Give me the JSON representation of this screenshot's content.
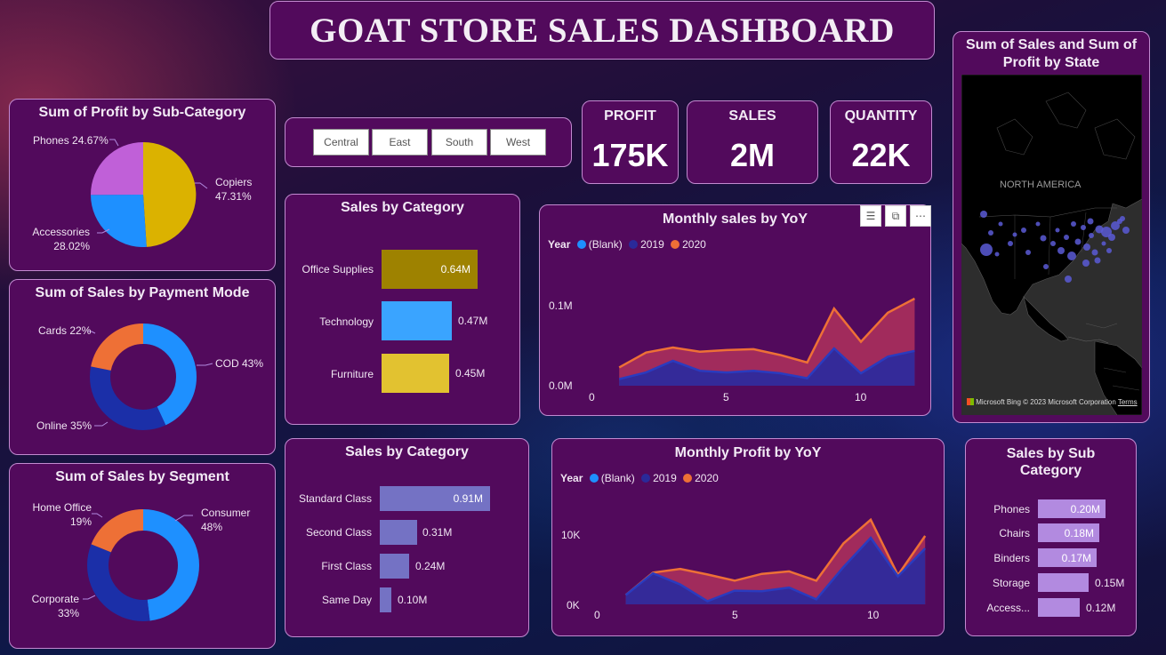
{
  "title": "GOAT STORE SALES DASHBOARD",
  "colors": {
    "card_bg": "#520a5c",
    "card_border": "#c28ad0",
    "blank": "#1e90ff",
    "y2019": "#2a2a9a",
    "y2020": "#ee7036",
    "copiers": "#dbb200",
    "accessories": "#1e90ff",
    "phones": "#c060d8",
    "shipmode_bar": "#7472c4",
    "subcat_bar": "#b28ae0"
  },
  "filters": {
    "regions": [
      "Central",
      "East",
      "South",
      "West"
    ]
  },
  "kpis": [
    {
      "label": "PROFIT",
      "value": "175K"
    },
    {
      "label": "SALES",
      "value": "2M"
    },
    {
      "label": "QUANTITY",
      "value": "22K"
    }
  ],
  "profit_subcat": {
    "title": "Sum of Profit by Sub-Category",
    "slices": [
      {
        "name": "Copiers",
        "pct_label": "47.31%",
        "value": 47.31
      },
      {
        "name": "Accessories",
        "pct_label": "28.02%",
        "value": 28.02
      },
      {
        "name": "Phones",
        "pct_label": "24.67%",
        "value": 24.67
      }
    ],
    "label_phones": "Phones 24.67%"
  },
  "payment_mode": {
    "title": "Sum of Sales by Payment Mode",
    "slices": [
      {
        "name": "COD",
        "value": 43,
        "label": "COD 43%"
      },
      {
        "name": "Online",
        "value": 35,
        "label": "Online 35%"
      },
      {
        "name": "Cards",
        "value": 22,
        "label": "Cards 22%"
      }
    ]
  },
  "segment": {
    "title": "Sum of Sales by Segment",
    "slices": [
      {
        "name": "Consumer",
        "pct": "48%",
        "value": 48
      },
      {
        "name": "Corporate",
        "pct": "33%",
        "value": 33
      },
      {
        "name": "Home Office",
        "pct": "19%",
        "value": 19
      }
    ]
  },
  "sales_category": {
    "title": "Sales by Category",
    "bars": [
      {
        "name": "Office Supplies",
        "value": 0.64,
        "label": "0.64M"
      },
      {
        "name": "Technology",
        "value": 0.47,
        "label": "0.47M"
      },
      {
        "name": "Furniture",
        "value": 0.45,
        "label": "0.45M"
      }
    ]
  },
  "ship_mode": {
    "title": "Sales by Category",
    "bars": [
      {
        "name": "Standard Class",
        "value": 0.91,
        "label": "0.91M"
      },
      {
        "name": "Second Class",
        "value": 0.31,
        "label": "0.31M"
      },
      {
        "name": "First Class",
        "value": 0.24,
        "label": "0.24M"
      },
      {
        "name": "Same Day",
        "value": 0.1,
        "label": "0.10M"
      }
    ]
  },
  "sub_category": {
    "title_line1": "Sales by Sub",
    "title_line2": "Category",
    "bars": [
      {
        "name": "Phones",
        "value": 0.2,
        "label": "0.20M"
      },
      {
        "name": "Chairs",
        "value": 0.18,
        "label": "0.18M"
      },
      {
        "name": "Binders",
        "value": 0.17,
        "label": "0.17M"
      },
      {
        "name": "Storage",
        "value": 0.15,
        "label": "0.15M"
      },
      {
        "name": "Access...",
        "value": 0.12,
        "label": "0.12M"
      }
    ]
  },
  "map": {
    "title_line1": "Sum of Sales and Sum of",
    "title_line2": "Profit by State",
    "region_label": "NORTH AMERICA",
    "attribution": "© 2023 Microsoft Corporation",
    "terms": "Terms",
    "brand": "Microsoft Bing"
  },
  "legend": {
    "title": "Year",
    "blank": "(Blank)",
    "y2019": "2019",
    "y2020": "2020"
  },
  "chart_data": [
    {
      "type": "area",
      "title": "Monthly sales by YoY",
      "x": [
        1,
        2,
        3,
        4,
        5,
        6,
        7,
        8,
        9,
        10,
        11,
        12
      ],
      "xticks": [
        "0",
        "5",
        "10"
      ],
      "yticks": [
        "0.0M",
        "0.1M"
      ],
      "ylim": [
        0,
        0.12
      ],
      "series": [
        {
          "name": "2019",
          "values": [
            0.008,
            0.016,
            0.03,
            0.018,
            0.016,
            0.018,
            0.015,
            0.009,
            0.045,
            0.015,
            0.035,
            0.042
          ]
        },
        {
          "name": "2020",
          "values": [
            0.022,
            0.04,
            0.046,
            0.041,
            0.043,
            0.044,
            0.037,
            0.028,
            0.093,
            0.053,
            0.088,
            0.105
          ]
        }
      ]
    },
    {
      "type": "area",
      "title": "Monthly Profit by YoY",
      "x": [
        1,
        2,
        3,
        4,
        5,
        6,
        7,
        8,
        9,
        10,
        11,
        12
      ],
      "xticks": [
        "0",
        "5",
        "10"
      ],
      "yticks": [
        "0K",
        "10K"
      ],
      "ylim": [
        0,
        16000
      ],
      "series": [
        {
          "name": "2019",
          "values": [
            1500,
            5000,
            3200,
            500,
            2200,
            2100,
            2700,
            800,
            6000,
            10700,
            4500,
            9000
          ]
        },
        {
          "name": "2020",
          "values": [
            1500,
            5100,
            5700,
            4800,
            3800,
            4900,
            5300,
            3800,
            9800,
            13600,
            4700,
            11000
          ]
        }
      ]
    }
  ]
}
